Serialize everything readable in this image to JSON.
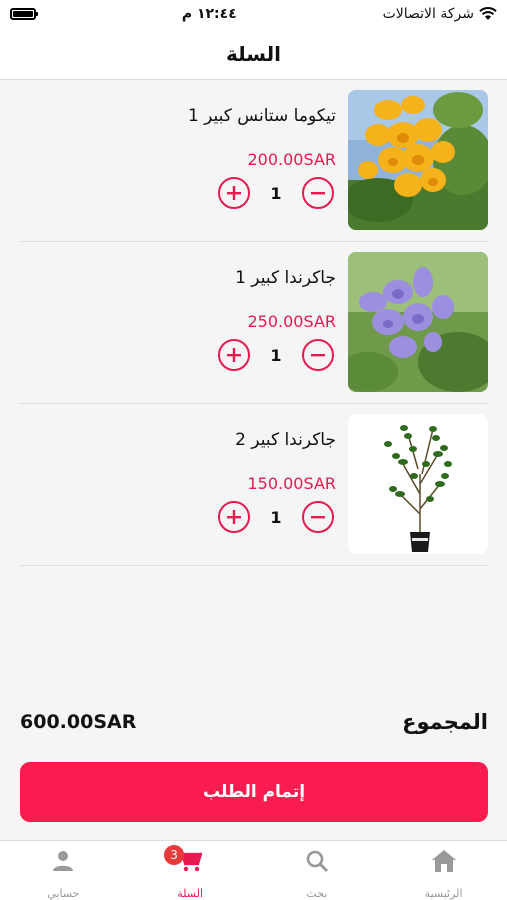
{
  "status_bar": {
    "carrier": "شركة الاتصالات",
    "time": "١٢:٤٤ م"
  },
  "header": {
    "title": "السلة"
  },
  "cart": {
    "items": [
      {
        "name": "تيكوما ستانس كبير 1",
        "price": "200.00SAR",
        "quantity": "1",
        "image": "yellow-flowers-image"
      },
      {
        "name": "جاكرندا كبير 1",
        "price": "250.00SAR",
        "quantity": "1",
        "image": "purple-flowers-image"
      },
      {
        "name": "جاكرندا كبير 2",
        "price": "150.00SAR",
        "quantity": "1",
        "image": "potted-sapling-image"
      }
    ],
    "total_label": "المجموع",
    "total_amount": "600.00SAR",
    "checkout_label": "إتمام الطلب"
  },
  "tab_bar": {
    "tabs": [
      {
        "label": "حسابي",
        "icon": "person-icon"
      },
      {
        "label": "السلة",
        "icon": "cart-icon",
        "badge": "3",
        "active": true
      },
      {
        "label": "بحث",
        "icon": "search-icon"
      },
      {
        "label": "الرئيسية",
        "icon": "home-icon"
      }
    ]
  },
  "colors": {
    "accent": "#fa1c4e",
    "price": "#e8194f",
    "badge": "#e83a3a"
  }
}
